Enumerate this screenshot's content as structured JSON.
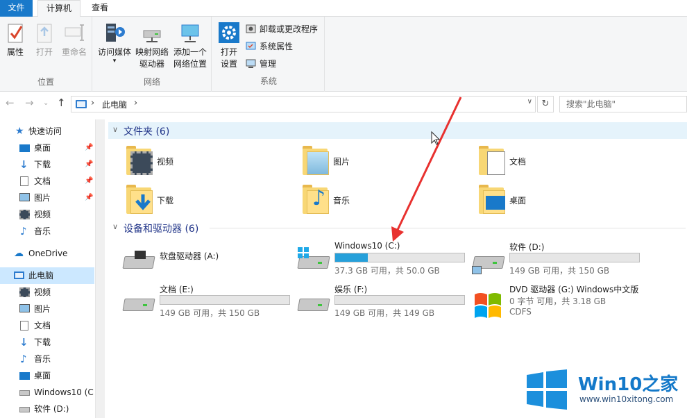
{
  "ribbon_tabs": {
    "file": "文件",
    "computer": "计算机",
    "view": "查看"
  },
  "ribbon": {
    "location": {
      "label": "位置",
      "properties": "属性",
      "open": "打开",
      "rename": "重命名"
    },
    "network": {
      "label": "网络",
      "access_media": "访问媒体",
      "map_drive_1": "映射网络",
      "map_drive_2": "驱动器",
      "add_location_1": "添加一个",
      "add_location_2": "网络位置"
    },
    "system": {
      "label": "系统",
      "open_settings_1": "打开",
      "open_settings_2": "设置",
      "uninstall": "卸载或更改程序",
      "system_properties": "系统属性",
      "manage": "管理"
    }
  },
  "address": {
    "crumb": "此电脑",
    "search_placeholder": "搜索\"此电脑\""
  },
  "nav": {
    "quick_access": "快速访问",
    "items": [
      {
        "label": "桌面",
        "icon": "desktop-icon"
      },
      {
        "label": "下载",
        "icon": "download-icon"
      },
      {
        "label": "文档",
        "icon": "document-icon"
      },
      {
        "label": "图片",
        "icon": "picture-icon"
      },
      {
        "label": "视频",
        "icon": "video-icon"
      },
      {
        "label": "音乐",
        "icon": "music-icon"
      }
    ],
    "onedrive": "OneDrive",
    "this_pc": "此电脑",
    "pc_items": [
      {
        "label": "视频"
      },
      {
        "label": "图片"
      },
      {
        "label": "文档"
      },
      {
        "label": "下载"
      },
      {
        "label": "音乐"
      },
      {
        "label": "桌面"
      },
      {
        "label": "Windows10 (C:"
      },
      {
        "label": "软件 (D:)"
      }
    ]
  },
  "folders_group": {
    "title": "文件夹 (6)"
  },
  "folders": [
    {
      "label": "视频",
      "icon": "video-folder-icon"
    },
    {
      "label": "图片",
      "icon": "picture-folder-icon"
    },
    {
      "label": "文档",
      "icon": "document-folder-icon"
    },
    {
      "label": "下载",
      "icon": "download-folder-icon"
    },
    {
      "label": "音乐",
      "icon": "music-folder-icon"
    },
    {
      "label": "桌面",
      "icon": "desktop-folder-icon"
    }
  ],
  "drives_group": {
    "title": "设备和驱动器 (6)"
  },
  "drives": [
    {
      "name": "软盘驱动器 (A:)",
      "used_fraction": null,
      "free": "",
      "fs": ""
    },
    {
      "name": "Windows10 (C:)",
      "used_fraction": 0.254,
      "free": "37.3 GB 可用，共 50.0 GB",
      "fs": ""
    },
    {
      "name": "软件 (D:)",
      "used_fraction": 0.0,
      "free": "149 GB 可用，共 150 GB",
      "fs": ""
    },
    {
      "name": "文档 (E:)",
      "used_fraction": 0.0,
      "free": "149 GB 可用，共 150 GB",
      "fs": ""
    },
    {
      "name": "娱乐 (F:)",
      "used_fraction": 0.0,
      "free": "149 GB 可用，共 149 GB",
      "fs": ""
    },
    {
      "name": "DVD 驱动器 (G:) Windows中文版",
      "used_fraction": null,
      "free": "0 字节 可用，共 3.18 GB",
      "fs": "CDFS"
    }
  ],
  "watermark": {
    "brand": "Win10",
    "brand_zh": "之家",
    "url": "www.win10xitong.com"
  },
  "colors": {
    "accent": "#1979ca",
    "selection": "#cce8ff",
    "drive_fill": "#26a0da",
    "arrow": "#e8312f"
  }
}
